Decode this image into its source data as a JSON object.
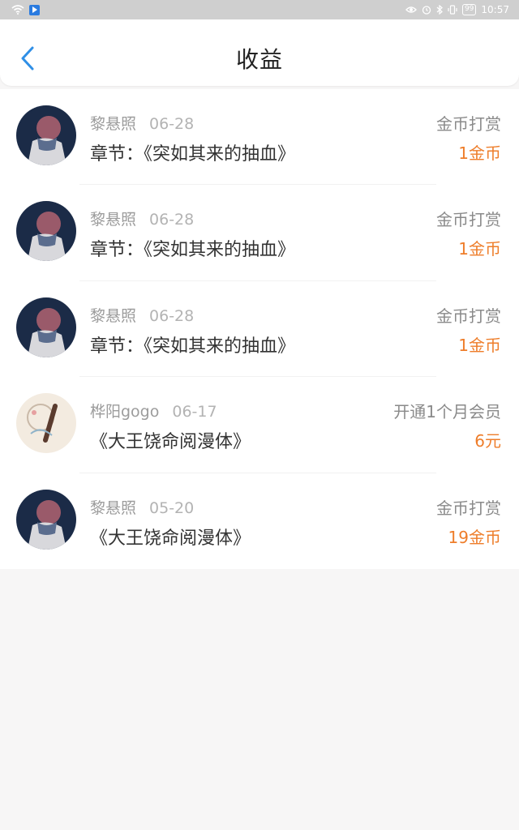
{
  "status_bar": {
    "time": "10:57",
    "battery": "99",
    "icons": [
      "wifi-icon",
      "app-notification-icon",
      "eye-icon",
      "alarm-icon",
      "bluetooth-icon",
      "vibrate-icon",
      "battery-icon"
    ]
  },
  "header": {
    "title": "收益",
    "back_icon": "chevron-left-icon",
    "accent_color": "#2f8fe6"
  },
  "colors": {
    "amount": "#ee7d2a",
    "name": "#9c9c9c",
    "title": "#333333"
  },
  "rows": [
    {
      "name": "黎悬照",
      "date": "06-28",
      "title": "章节：《突如其来的抽血》",
      "type": "金币打赏",
      "amount": "1金币",
      "avatar": "dark-portrait"
    },
    {
      "name": "黎悬照",
      "date": "06-28",
      "title": "章节：《突如其来的抽血》",
      "type": "金币打赏",
      "amount": "1金币",
      "avatar": "dark-portrait"
    },
    {
      "name": "黎悬照",
      "date": "06-28",
      "title": "章节：《突如其来的抽血》",
      "type": "金币打赏",
      "amount": "1金币",
      "avatar": "dark-portrait"
    },
    {
      "name": "桦阳gogo",
      "date": "06-17",
      "title": "《大王饶命阅漫体》",
      "type": "开通1个月会员",
      "amount": "6元",
      "avatar": "light-sketch"
    },
    {
      "name": "黎悬照",
      "date": "05-20",
      "title": "《大王饶命阅漫体》",
      "type": "金币打赏",
      "amount": "19金币",
      "avatar": "dark-portrait"
    }
  ]
}
